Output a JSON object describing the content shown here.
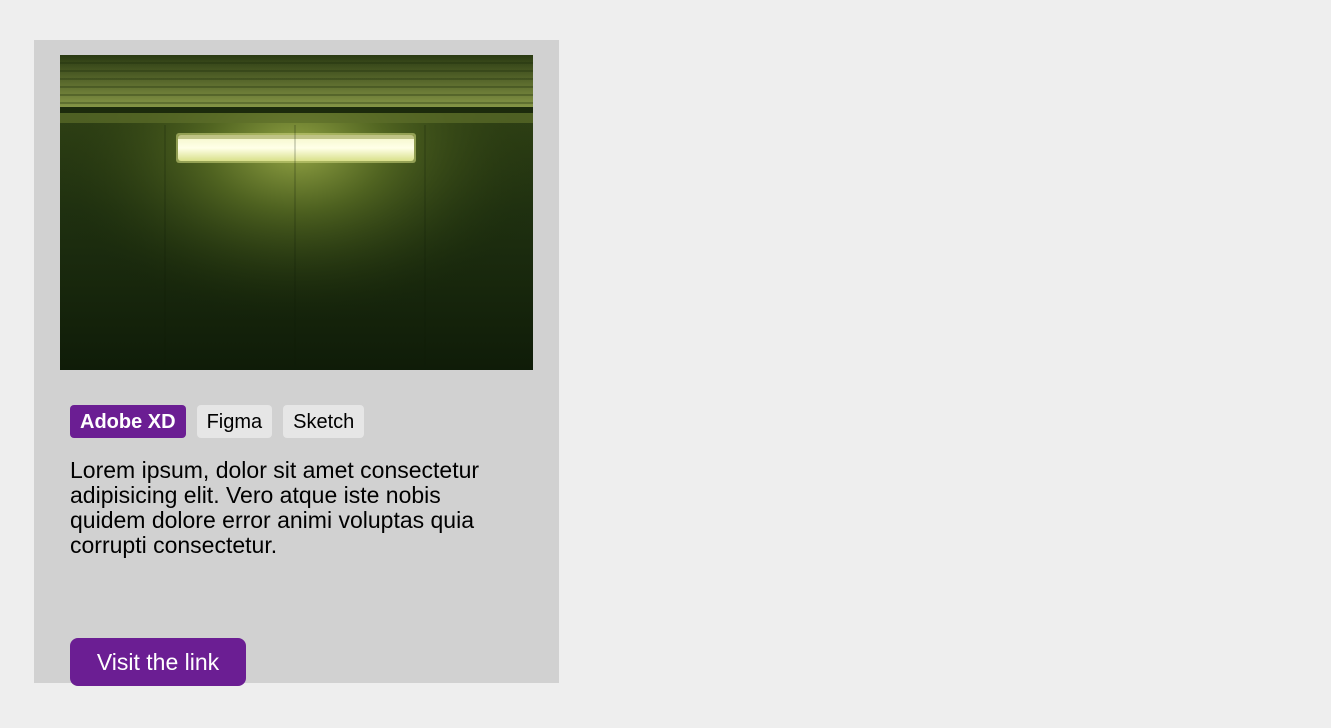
{
  "card": {
    "image": {
      "description_icon": "fluorescent-light-photo"
    },
    "tags": [
      {
        "label": "Adobe XD",
        "active": true
      },
      {
        "label": "Figma",
        "active": false
      },
      {
        "label": "Sketch",
        "active": false
      }
    ],
    "description": "Lorem ipsum, dolor sit amet consectetur adipisicing elit. Vero atque iste nobis quidem dolore error animi voluptas quia corrupti consectetur.",
    "button_label": "Visit the link"
  },
  "colors": {
    "page_background": "#eeeeee",
    "card_background": "#d1d1d1",
    "accent": "#6b1e93",
    "tag_background": "#e6e6e6"
  }
}
